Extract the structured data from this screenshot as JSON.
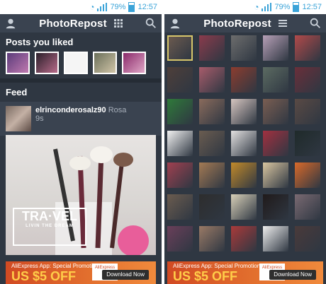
{
  "status": {
    "battery": "79%",
    "time": "12:57"
  },
  "left": {
    "app_title": "PhotoRepost",
    "liked_title": "Posts you liked",
    "feed_title": "Feed",
    "post": {
      "username": "elrinconderosalz90",
      "secondary": "Rosa",
      "time": "9s"
    },
    "travel_text": "TRA·VEL",
    "travel_sub": "LIVIN THE DREAM",
    "ad": {
      "top_text": "AliExpress App: Special Promotion",
      "big_text": "US $5 OFF",
      "button": "Download Now",
      "logo": "AliExpress"
    },
    "liked_thumbs": [
      "#5b3b7a",
      "#2a1f2a",
      "#f5f5f5",
      "#6a6f5a",
      "#8a2a6a"
    ]
  },
  "right": {
    "app_title": "PhotoRepost",
    "ad": {
      "top_text": "AliExpress App: Special Promotion",
      "big_text": "US $5 OFF",
      "button": "Download Now",
      "logo": "AliExpress"
    },
    "grid_colors": [
      "#6b5a4f",
      "#8a3b4c",
      "#6d6d6d",
      "#b7a0b7",
      "#b24a4a",
      "#4e3f3a",
      "#a85c6b",
      "#8c3d2f",
      "#5c6b62",
      "#6a2f3a",
      "#2f7a3a",
      "#8a6b5c",
      "#d6c6c0",
      "#7a5e52",
      "#5a4a44",
      "#f2f2f2",
      "#6a5c50",
      "#e3e1e1",
      "#a23040",
      "#1f2a2a",
      "#a04050",
      "#a47a54",
      "#c28a2a",
      "#d9c6a0",
      "#d96a2a",
      "#6b5c4f",
      "#2d2d2d",
      "#d8d0b8",
      "#201a1a",
      "#7a6a72",
      "#6a3f5a",
      "#9a7a66",
      "#aa3a3a",
      "#eeeeee",
      "#4a3a3a"
    ]
  }
}
